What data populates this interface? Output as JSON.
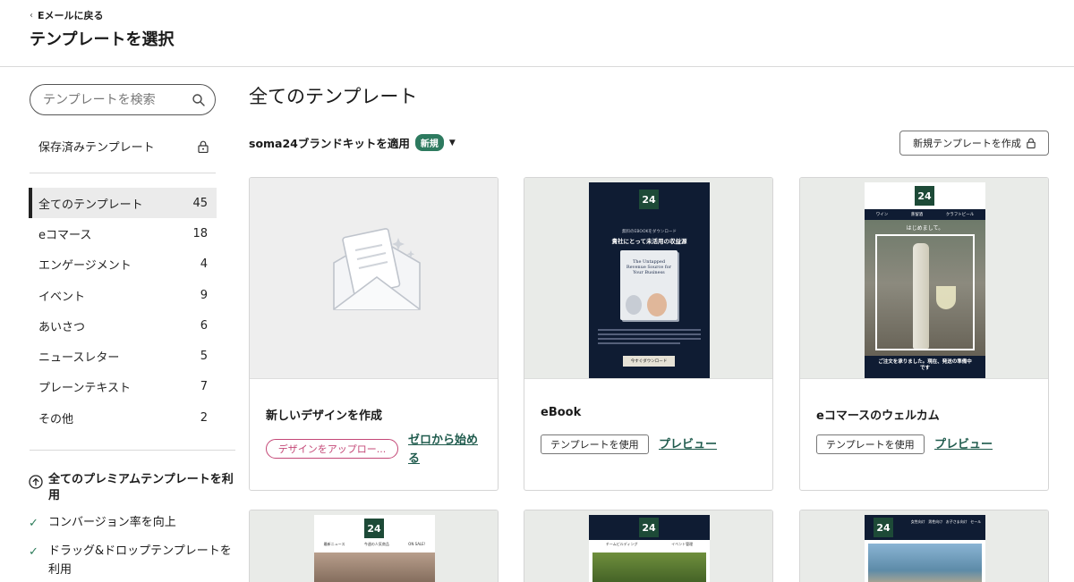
{
  "header": {
    "back_label": "Eメールに戻る",
    "title": "テンプレートを選択"
  },
  "sidebar": {
    "search_placeholder": "テンプレートを検索",
    "saved_label": "保存済みテンプレート",
    "categories": [
      {
        "label": "全てのテンプレート",
        "count": "45",
        "active": true
      },
      {
        "label": "eコマース",
        "count": "18"
      },
      {
        "label": "エンゲージメント",
        "count": "4"
      },
      {
        "label": "イベント",
        "count": "9"
      },
      {
        "label": "あいさつ",
        "count": "6"
      },
      {
        "label": "ニュースレター",
        "count": "5"
      },
      {
        "label": "プレーンテキスト",
        "count": "7"
      },
      {
        "label": "その他",
        "count": "2"
      }
    ],
    "premium": {
      "title": "全てのプレミアムテンプレートを利用",
      "items": [
        "コンバージョン率を向上",
        "ドラッグ&ドロップテンプレートを利用"
      ]
    }
  },
  "main": {
    "title": "全てのテンプレート",
    "brand_kit": "soma24ブランドキットを適用",
    "badge_new": "新規",
    "new_template_button": "新規テンプレートを作成",
    "cards": [
      {
        "title": "新しいデザインを作成",
        "upload_button": "デザインをアップロー...",
        "scratch_link": "ゼロから始める"
      },
      {
        "title": "eBook",
        "use_button": "テンプレートを使用",
        "preview_link": "プレビュー"
      },
      {
        "title": "eコマースのウェルカム",
        "use_button": "テンプレートを使用",
        "preview_link": "プレビュー"
      }
    ],
    "thumb_ebook": {
      "logo": "24",
      "kicker": "無料のEBOOKをダウンロード",
      "headline": "貴社にとって未活用の収益源",
      "book_title": "The Untapped Revenue Source for Your Business",
      "cta": "今すぐダウンロード"
    },
    "thumb_ecom": {
      "logo": "24",
      "nav": [
        "ワイン",
        "蒸留酒",
        "クラフトビール"
      ],
      "greeting": "はじめまして。",
      "text": "ご注文を承りました。現在、発送の準備中です"
    },
    "thumb_row2": [
      {
        "logo": "24",
        "nav": [
          "最新ニュース",
          "今週の人気商品",
          "ON SALE!"
        ]
      },
      {
        "logo": "24",
        "nav": [
          "チームビルディング",
          "イベント管理"
        ]
      },
      {
        "logo": "24",
        "nav": [
          "女性向け",
          "男性向け",
          "お子さま向け",
          "セール"
        ]
      }
    ]
  },
  "colors": {
    "brand_green": "#2d7a5f",
    "link_green": "#1f5b4d",
    "pink": "#c44877",
    "navy": "#0f1c33"
  }
}
